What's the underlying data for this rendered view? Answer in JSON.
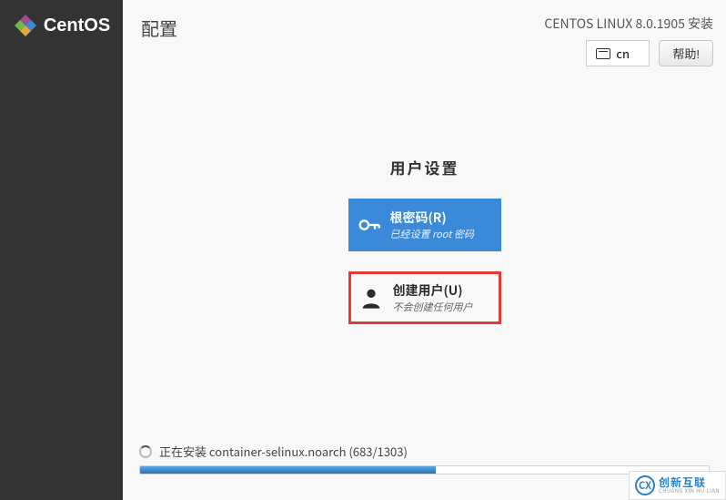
{
  "brand": {
    "name": "CentOS"
  },
  "header": {
    "page_title": "配置",
    "subtitle": "CENTOS LINUX 8.0.1905 安装",
    "lang": "cn",
    "help_label": "帮助!"
  },
  "user_settings": {
    "section_title": "用户设置",
    "root": {
      "title": "根密码(R)",
      "subtitle": "已经设置 root 密码"
    },
    "create_user": {
      "title": "创建用户(U)",
      "subtitle": "不会创建任何用户"
    }
  },
  "install": {
    "status_text": "正在安装 container-selinux.noarch (683/1303)",
    "progress_percent": 52
  },
  "watermark": {
    "logo_text": "CX",
    "zh": "创新互联",
    "en": "CHUANG XIN HU LIAN"
  }
}
